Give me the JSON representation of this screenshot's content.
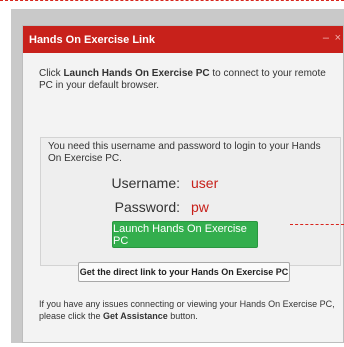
{
  "titlebar": {
    "title": "Hands On Exercise Link",
    "minimize": "–",
    "close": "×"
  },
  "intro": {
    "prefix": "Click ",
    "link": "Launch Hands On Exercise PC",
    "suffix": " to connect to your remote PC in your default browser."
  },
  "panel": {
    "message": "You need this username and password to login to your Hands On Exercise PC.",
    "username_label": "Username:",
    "username_value": "user",
    "password_label": "Password:",
    "password_value": "pw",
    "launch_label": "Launch Hands On Exercise PC"
  },
  "direct_link_label": "Get the direct link to your Hands On Exercise PC",
  "footer": {
    "prefix": "If you have any issues connecting or viewing your Hands On Exercise PC, please click the ",
    "bold": "Get Assistance",
    "suffix": " button."
  },
  "colors": {
    "titlebar": "#c8211b",
    "launch_button": "#33ae4d",
    "credential_value": "#c7201a"
  }
}
